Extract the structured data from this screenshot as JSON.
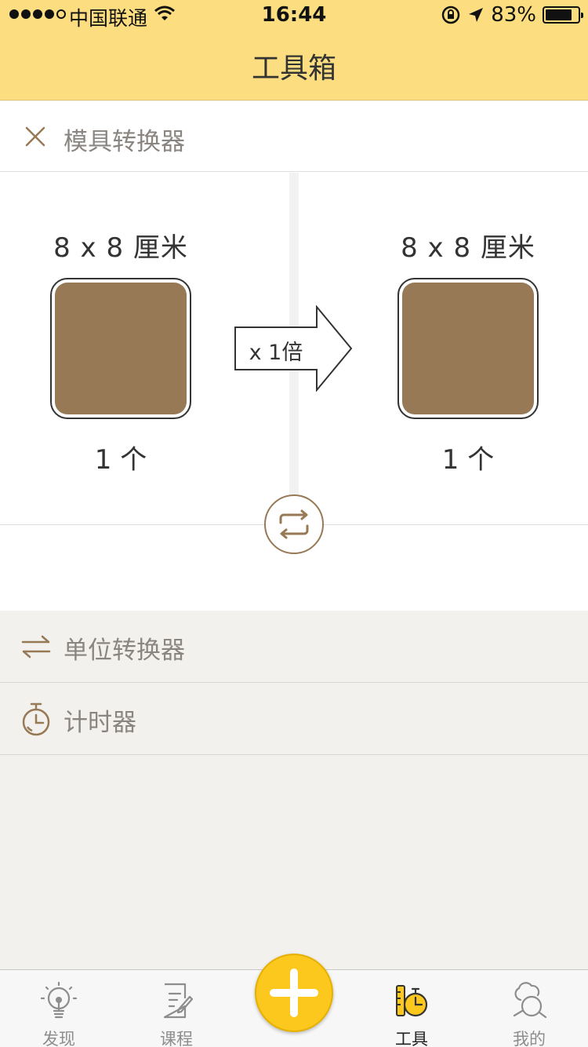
{
  "status_bar": {
    "carrier": "中国联通",
    "time": "16:44",
    "battery": "83%",
    "battery_level": 0.83
  },
  "nav": {
    "title": "工具箱"
  },
  "mold_converter": {
    "title": "模具转换器",
    "source": {
      "size": "8 x 8  厘米",
      "count": "1  个"
    },
    "target": {
      "size": "8 x 8  厘米",
      "count": "1  个"
    },
    "multiplier": "x 1倍",
    "mold_color": "#977955"
  },
  "tools": [
    {
      "label": "单位转换器",
      "icon": "swap-arrows-icon"
    },
    {
      "label": "计时器",
      "icon": "stopwatch-icon"
    }
  ],
  "tabbar": {
    "tabs": [
      {
        "label": "发现",
        "icon": "lightbulb-icon"
      },
      {
        "label": "课程",
        "icon": "notebook-icon"
      },
      {
        "label": "工具",
        "icon": "tools-icon"
      },
      {
        "label": "我的",
        "icon": "chef-icon"
      }
    ],
    "add_icon": "plus-icon"
  },
  "colors": {
    "nav_bg": "#fcdd80",
    "accent": "#977955",
    "add_button": "#fcc81d"
  }
}
